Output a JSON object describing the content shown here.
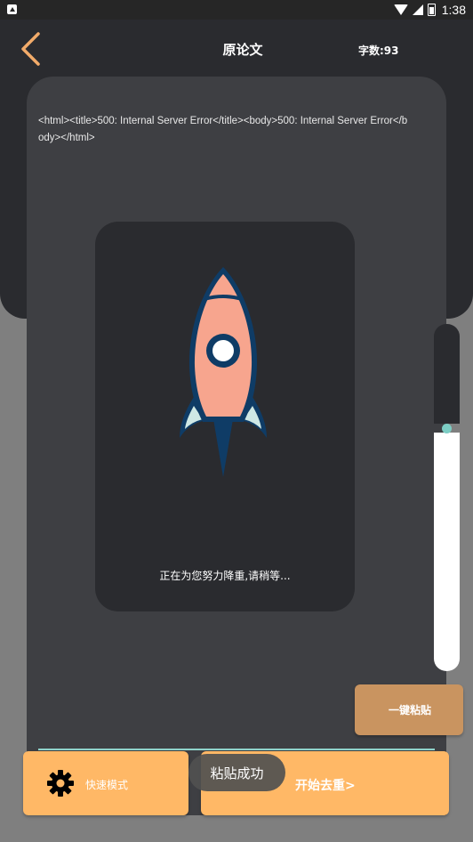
{
  "status_bar": {
    "time": "1:38"
  },
  "header": {
    "title": "原论文",
    "word_count": "字数:93"
  },
  "paper": {
    "text": "<html><title>500: Internal Server Error</title><body>500: Internal Server Error</body></html>"
  },
  "loading": {
    "message": "正在为您努力降重,请稍等..."
  },
  "slider": {
    "level": 0.32
  },
  "buttons": {
    "paste": "一键粘贴",
    "quick_mode": "快速模式",
    "start": "开始去重>"
  },
  "toast": {
    "message": "粘贴成功"
  },
  "colors": {
    "accent": "#ffb866",
    "back_arrow": "#f2ab6a",
    "header_bg": "#2a2b2f",
    "card_bg": "#3e3f43",
    "rocket_body": "#f7a58e",
    "rocket_outline": "#0f3c66",
    "slider_thumb": "#7ccdc4"
  }
}
